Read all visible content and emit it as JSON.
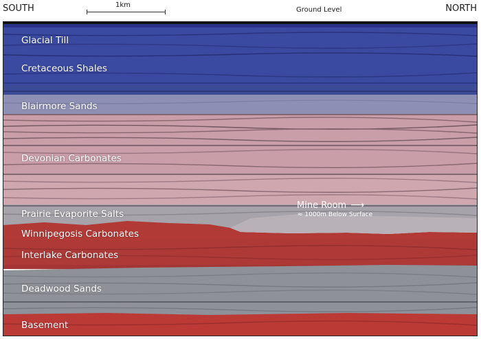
{
  "header": {
    "south": "SOUTH",
    "north": "NORTH",
    "ground": "Ground Level",
    "scale": "1km"
  },
  "layers": [
    {
      "label": "Glacial Till",
      "color": "#2f3f9a"
    },
    {
      "label": "Cretaceous Shales",
      "color": "#36479f"
    },
    {
      "label": "Blairmore Sands",
      "color": "#8c8fb4"
    },
    {
      "label": "Devonian Carbonates",
      "color": "#c49ca6"
    },
    {
      "label": "Prairie Evaporite Salts",
      "color": "#a9a5ac"
    },
    {
      "label": "Winnipegosis Carbonates",
      "color": "#b23a35"
    },
    {
      "label": "Interlake Carbonates",
      "color": "#b0393a"
    },
    {
      "label": "Deadwood Sands",
      "color": "#8e9097"
    },
    {
      "label": "Basement",
      "color": "#bb3a36"
    }
  ],
  "annotation": {
    "title": "Mine Room",
    "arrow": "⟶",
    "depth": "≈ 1000m Below Surface"
  }
}
